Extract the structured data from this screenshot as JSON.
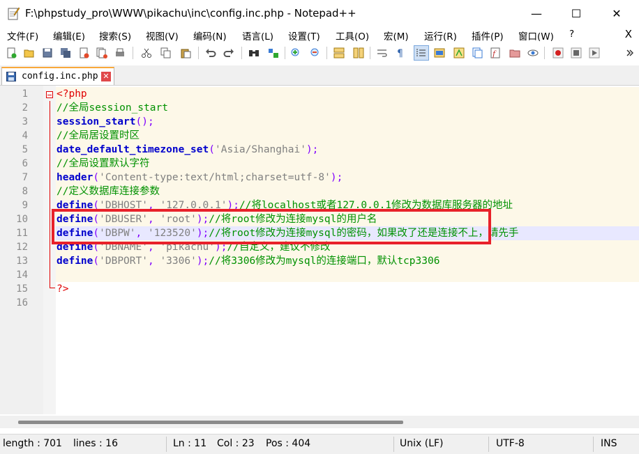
{
  "window": {
    "title": "F:\\phpstudy_pro\\WWW\\pikachu\\inc\\config.inc.php - Notepad++",
    "minimize": "—",
    "maximize": "☐",
    "close": "✕"
  },
  "menu": {
    "items": [
      {
        "label": "文件(F)"
      },
      {
        "label": "编辑(E)"
      },
      {
        "label": "搜索(S)"
      },
      {
        "label": "视图(V)"
      },
      {
        "label": "编码(N)"
      },
      {
        "label": "语言(L)"
      },
      {
        "label": "设置(T)"
      },
      {
        "label": "工具(O)"
      },
      {
        "label": "宏(M)"
      },
      {
        "label": "运行(R)"
      },
      {
        "label": "插件(P)"
      },
      {
        "label": "窗口(W)"
      },
      {
        "label": "?"
      }
    ],
    "close_label": "X"
  },
  "tab": {
    "label": "config.inc.php",
    "close": "✕"
  },
  "editor": {
    "line_numbers": [
      "1",
      "2",
      "3",
      "4",
      "5",
      "6",
      "7",
      "8",
      "9",
      "10",
      "11",
      "12",
      "13",
      "14",
      "15",
      "16"
    ],
    "lines": {
      "l1": {
        "tag": "<?php"
      },
      "l2": {
        "comment": "//全局session_start"
      },
      "l3": {
        "fn": "session_start",
        "rest": "();"
      },
      "l4": {
        "comment": "//全局居设置时区"
      },
      "l5": {
        "fn": "date_default_timezone_set",
        "open": "(",
        "str": "'Asia/Shanghai'",
        "close": ");"
      },
      "l6": {
        "comment": "//全局设置默认字符"
      },
      "l7": {
        "fn": "header",
        "open": "(",
        "str": "'Content-type:text/html;charset=utf-8'",
        "close": ");"
      },
      "l8": {
        "comment": "//定义数据库连接参数"
      },
      "l9": {
        "fn": "define",
        "open": "(",
        "a1": "'DBHOST'",
        "sep": ", ",
        "a2": "'127.0.0.1'",
        "close": ");",
        "comment": "//将localhost或者127.0.0.1修改为数据库服务器的地址"
      },
      "l10": {
        "fn": "define",
        "open": "(",
        "a1": "'DBUSER'",
        "sep": ", ",
        "a2": "'root'",
        "close": ");",
        "comment": "//将root修改为连接mysql的用户名"
      },
      "l11": {
        "fn": "define",
        "open": "(",
        "a1": "'DBPW'",
        "sep": ", ",
        "a2": "'123520'",
        "close": ");",
        "comment": "//将root修改为连接mysql的密码，如果改了还是连接不上，请先手"
      },
      "l12": {
        "fn": "define",
        "open": "(",
        "a1": "'DBNAME'",
        "sep": ", ",
        "a2": "'pikachu'",
        "close": ");",
        "comment": "//自定义，建议不修改"
      },
      "l13": {
        "fn": "define",
        "open": "(",
        "a1": "'DBPORT'",
        "sep": ", ",
        "a2": "'3306'",
        "close": ");",
        "comment": "//将3306修改为mysql的连接端口，默认tcp3306"
      },
      "l15": {
        "tag": "?>"
      }
    }
  },
  "status": {
    "length": "length : 701",
    "lines": "lines : 16",
    "ln": "Ln : 11",
    "col": "Col : 23",
    "pos": "Pos : 404",
    "eol": "Unix (LF)",
    "encoding": "UTF-8",
    "mode": "INS"
  }
}
